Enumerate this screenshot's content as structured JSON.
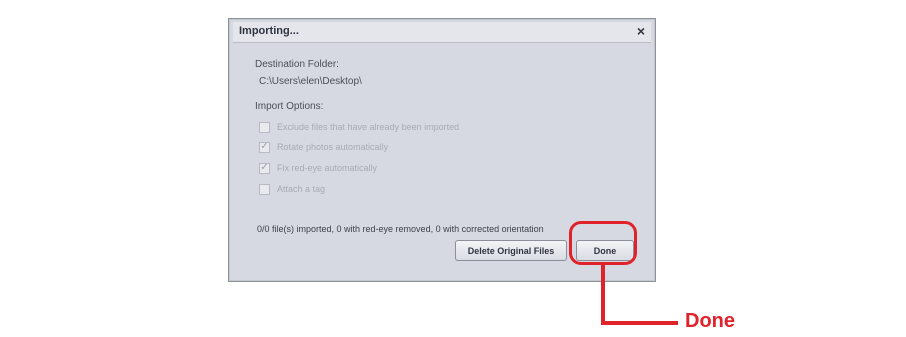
{
  "dialog": {
    "title": "Importing...",
    "close_glyph": "×",
    "destination_label": "Destination Folder:",
    "destination_path": "C:\\Users\\elen\\Desktop\\",
    "import_options_label": "Import Options:",
    "options": [
      {
        "label": "Exclude files that have already been imported",
        "checked": false
      },
      {
        "label": "Rotate photos automatically",
        "checked": true
      },
      {
        "label": "Fix red-eye automatically",
        "checked": true
      },
      {
        "label": "Attach a tag",
        "checked": false
      }
    ],
    "status": "0/0 file(s) imported, 0 with red-eye removed, 0 with corrected orientation",
    "delete_button": "Delete Original Files",
    "done_button": "Done"
  },
  "callout": {
    "label": "Done",
    "color": "#e0222b"
  }
}
